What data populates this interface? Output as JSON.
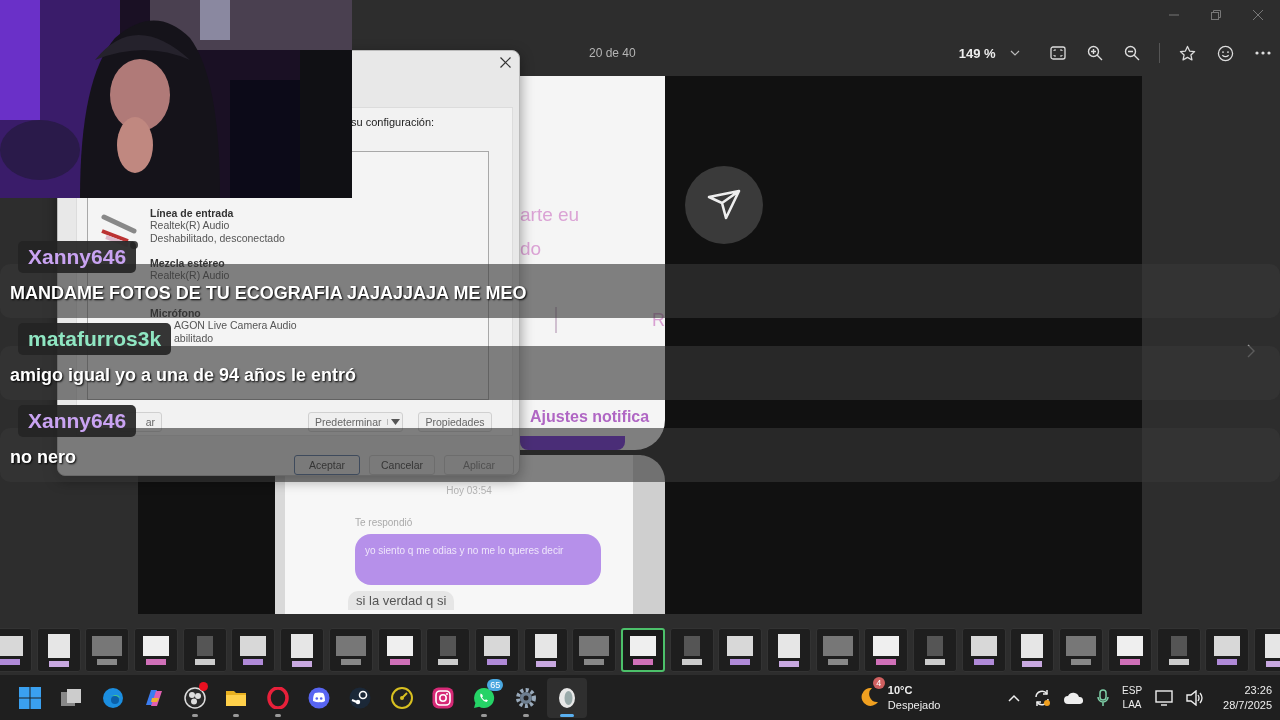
{
  "viewer": {
    "counter": "20 de 40",
    "zoom": "149 %"
  },
  "photo": {
    "snippets": [
      "arte eu",
      "do"
    ],
    "tab_label": "R",
    "settings_link": "Ajustes notifica",
    "timestamp": "Hoy 03:54",
    "reply_label": "Te respondió",
    "messages": [
      {
        "text": "yo siento q me odias y no me lo queres decir",
        "outgoing": true
      },
      {
        "text": "si la verdad q si",
        "outgoing": false
      }
    ]
  },
  "dialog": {
    "instruction": "su configuración:",
    "devices": [
      {
        "kind": "line-in",
        "name": "Línea de entrada",
        "lines": [
          "Realtek(R) Audio",
          "Deshabilitado, desconectado"
        ]
      },
      {
        "kind": "stereo-mix",
        "name": "Mezcla estéreo",
        "lines": [
          "Realtek(R) Audio"
        ]
      },
      {
        "kind": "microphone",
        "name": "Micrófono",
        "lines": [
          "AGON Live Camera Audio",
          "abilitado"
        ]
      }
    ],
    "buttons": [
      {
        "label": "ar",
        "kind": "plain"
      },
      {
        "label": "Predeterminar",
        "kind": "split"
      },
      {
        "label": "Propiedades",
        "kind": "plain"
      }
    ],
    "footer_buttons": [
      {
        "label": "Aceptar",
        "default": true,
        "disabled": false
      },
      {
        "label": "Cancelar",
        "default": false,
        "disabled": false
      },
      {
        "label": "Aplicar",
        "default": false,
        "disabled": true
      }
    ]
  },
  "chat": [
    {
      "user": "Xanny646",
      "color": "#c9a3f2",
      "message": "MANDAME FOTOS DE TU ECOGRAFIA JAJAJJAJA ME MEO"
    },
    {
      "user": "matafurros3k",
      "color": "#8fe6c2",
      "message": "amigo igual yo a una de 94 años le entró"
    },
    {
      "user": "Xanny646",
      "color": "#c9a3f2",
      "message": "no nero"
    }
  ],
  "thumbnails": [
    {
      "selected": false
    },
    {
      "selected": false
    },
    {
      "selected": false
    },
    {
      "selected": false
    },
    {
      "selected": false
    },
    {
      "selected": false
    },
    {
      "selected": false
    },
    {
      "selected": false
    },
    {
      "selected": false
    },
    {
      "selected": false
    },
    {
      "selected": false
    },
    {
      "selected": false
    },
    {
      "selected": false
    },
    {
      "selected": true
    },
    {
      "selected": false
    },
    {
      "selected": false
    },
    {
      "selected": false
    },
    {
      "selected": false
    },
    {
      "selected": false
    },
    {
      "selected": false
    },
    {
      "selected": false
    },
    {
      "selected": false
    },
    {
      "selected": false
    },
    {
      "selected": false
    },
    {
      "selected": false
    },
    {
      "selected": false
    },
    {
      "selected": false
    }
  ],
  "taskbar": {
    "apps": [
      {
        "kind": "start",
        "running": false,
        "selected": false,
        "alert": false
      },
      {
        "kind": "task-view",
        "running": false,
        "selected": false,
        "alert": false
      },
      {
        "kind": "edge",
        "running": false,
        "selected": false,
        "alert": false
      },
      {
        "kind": "copilot",
        "running": false,
        "selected": false,
        "alert": false
      },
      {
        "kind": "obs",
        "running": true,
        "selected": false,
        "alert": true
      },
      {
        "kind": "files",
        "running": true,
        "selected": false,
        "alert": false
      },
      {
        "kind": "opera",
        "running": true,
        "selected": false,
        "alert": false
      },
      {
        "kind": "discord",
        "running": false,
        "selected": false,
        "alert": false
      },
      {
        "kind": "steam",
        "running": false,
        "selected": false,
        "alert": false
      },
      {
        "kind": "gauge",
        "running": false,
        "selected": false,
        "alert": false
      },
      {
        "kind": "instagram",
        "running": false,
        "selected": false,
        "alert": false
      },
      {
        "kind": "whatsapp",
        "running": true,
        "selected": false,
        "alert": false,
        "badge": "65"
      },
      {
        "kind": "settings",
        "running": true,
        "selected": false,
        "alert": false
      },
      {
        "kind": "viewer",
        "running": true,
        "selected": true,
        "alert": false
      }
    ],
    "weather": {
      "badge": "4",
      "temperature": "10°C",
      "condition": "Despejado"
    },
    "language": [
      "ESP",
      "LAA"
    ],
    "time": "23:26",
    "date": "28/7/2025"
  }
}
